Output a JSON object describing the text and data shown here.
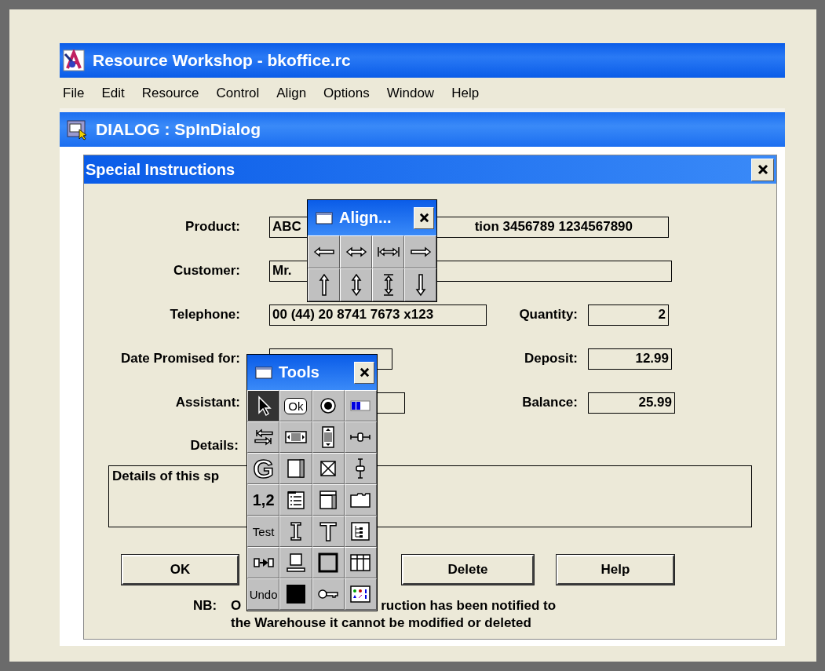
{
  "window": {
    "title": "Resource Workshop - bkoffice.rc"
  },
  "menu": [
    "File",
    "Edit",
    "Resource",
    "Control",
    "Align",
    "Options",
    "Window",
    "Help"
  ],
  "child_window": {
    "title": "DIALOG : SpInDialog"
  },
  "dialog": {
    "title": "Special Instructions",
    "rows": [
      {
        "label": "Product:",
        "visible_text": [
          "ABC",
          "tion 3456789 1234567890"
        ]
      },
      {
        "label": "Customer:",
        "visible_text": [
          "Mr."
        ]
      },
      {
        "label": "Telephone:",
        "visible_text": [
          "00 (44) 20 8741 7673 x123"
        ],
        "right": {
          "label": "Quantity:",
          "value": "2"
        }
      },
      {
        "label": "Date Promised for:",
        "visible_text": [],
        "right": {
          "label": "Deposit:",
          "value": "12.99"
        }
      },
      {
        "label": "Assistant:",
        "visible_text": [],
        "right": {
          "label": "Balance:",
          "value": "25.99"
        }
      }
    ],
    "details": {
      "label": "Details:",
      "visible_text": "Details of this sp"
    },
    "buttons": [
      "OK",
      "Delete",
      "Help"
    ],
    "note": {
      "label": "NB:",
      "line_1": [
        "O",
        "ruction has been notified to"
      ],
      "line_2": "the Warehouse it cannot be modified or deleted"
    }
  },
  "align_palette": {
    "title": "Align..."
  },
  "tools_palette": {
    "title": "Tools",
    "tools": [
      {
        "kind": "icon",
        "selected": true
      },
      {
        "kind": "boxed",
        "label": "Ok",
        "selected": false
      },
      {
        "kind": "icon",
        "selected": false
      },
      {
        "kind": "icon",
        "selected": false
      },
      {
        "kind": "icon",
        "selected": false
      },
      {
        "kind": "icon",
        "selected": false
      },
      {
        "kind": "icon",
        "selected": false
      },
      {
        "kind": "icon",
        "selected": false
      },
      {
        "kind": "outline",
        "label": "G",
        "selected": false
      },
      {
        "kind": "icon",
        "selected": false
      },
      {
        "kind": "icon",
        "selected": false
      },
      {
        "kind": "icon",
        "selected": false
      },
      {
        "kind": "text",
        "label": "1,2",
        "selected": false
      },
      {
        "kind": "icon",
        "selected": false
      },
      {
        "kind": "icon",
        "selected": false
      },
      {
        "kind": "icon",
        "selected": false
      },
      {
        "kind": "text",
        "label": "Test",
        "selected": false
      },
      {
        "kind": "icon",
        "selected": false
      },
      {
        "kind": "outline",
        "label": "T",
        "selected": false
      },
      {
        "kind": "icon",
        "selected": false
      },
      {
        "kind": "icon",
        "selected": false
      },
      {
        "kind": "icon",
        "selected": false
      },
      {
        "kind": "icon",
        "selected": false
      },
      {
        "kind": "icon",
        "selected": false
      },
      {
        "kind": "text",
        "label": "Undo",
        "selected": false
      },
      {
        "kind": "icon",
        "selected": false
      },
      {
        "kind": "icon",
        "selected": false
      },
      {
        "kind": "icon",
        "selected": false
      }
    ]
  }
}
